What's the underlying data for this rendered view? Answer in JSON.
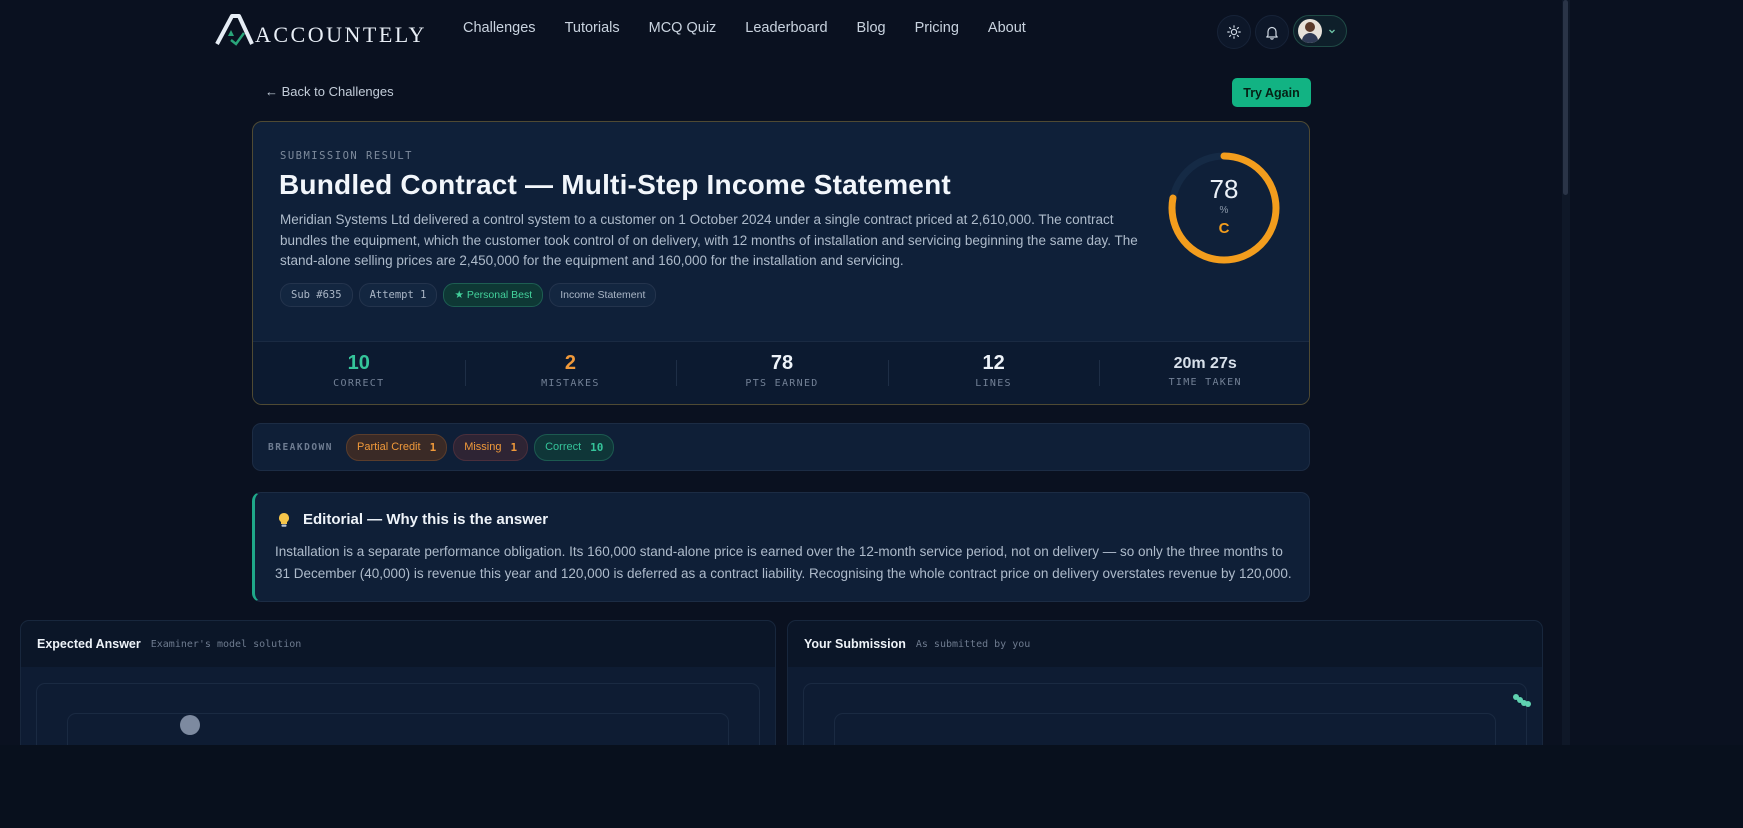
{
  "nav": {
    "brand": "ACCOUNTELY",
    "links": [
      "Challenges",
      "Tutorials",
      "MCQ Quiz",
      "Leaderboard",
      "Blog",
      "Pricing",
      "About"
    ],
    "icons": [
      "sun-icon",
      "bell-icon",
      "chevron-down-icon"
    ]
  },
  "actions": {
    "back": "← Back to Challenges",
    "try_again": "Try Again"
  },
  "result": {
    "eyebrow": "SUBMISSION RESULT",
    "title": "Bundled Contract — Multi-Step Income Statement",
    "description": "Meridian Systems Ltd delivered a control system to a customer on 1 October 2024 under a single contract priced at 2,610,000. The contract bundles the equipment, which the customer took control of on delivery, with 12 months of installation and servicing beginning the same day. The stand-alone selling prices are 2,450,000 for the equipment and 160,000 for the installation and servicing.",
    "chips": [
      "Sub #635",
      "Attempt 1",
      "★ Personal Best",
      "Income Statement"
    ],
    "score": {
      "value": "78",
      "unit": "%",
      "grade": "C",
      "percent": 78
    },
    "stats": [
      {
        "value": "10",
        "label": "CORRECT",
        "color": "#35c49a"
      },
      {
        "value": "2",
        "label": "MISTAKES",
        "color": "#f0993a"
      },
      {
        "value": "78",
        "label": "PTS EARNED",
        "color": "#eef3f9"
      },
      {
        "value": "12",
        "label": "LINES",
        "color": "#eef3f9"
      },
      {
        "value": "20m 27s",
        "label": "TIME TAKEN",
        "color": "#d8e0ea"
      }
    ]
  },
  "breakdown": {
    "label": "BREAKDOWN",
    "items": [
      {
        "label": "Partial Credit",
        "count": "1"
      },
      {
        "label": "Missing",
        "count": "1"
      },
      {
        "label": "Correct",
        "count": "10"
      }
    ]
  },
  "editorial": {
    "icon": "lightbulb-icon",
    "title": "Editorial — Why this is the answer",
    "text": "Installation is a separate performance obligation. Its 160,000 stand-alone price is earned over the 12-month service period, not on delivery — so only the three months to 31 December (40,000) is revenue this year and 120,000 is deferred as a contract liability. Recognising the whole contract price on delivery overstates revenue by 120,000."
  },
  "panels": {
    "expected": {
      "title": "Expected Answer",
      "subtitle": "Examiner's model solution"
    },
    "submission": {
      "title": "Your Submission",
      "subtitle": "As submitted by you"
    }
  },
  "colors": {
    "accent": "#12b383",
    "score_ring": "#f39d1d",
    "partial": "#f0993a",
    "missing": "#f0993a",
    "correct": "#35c49a"
  }
}
